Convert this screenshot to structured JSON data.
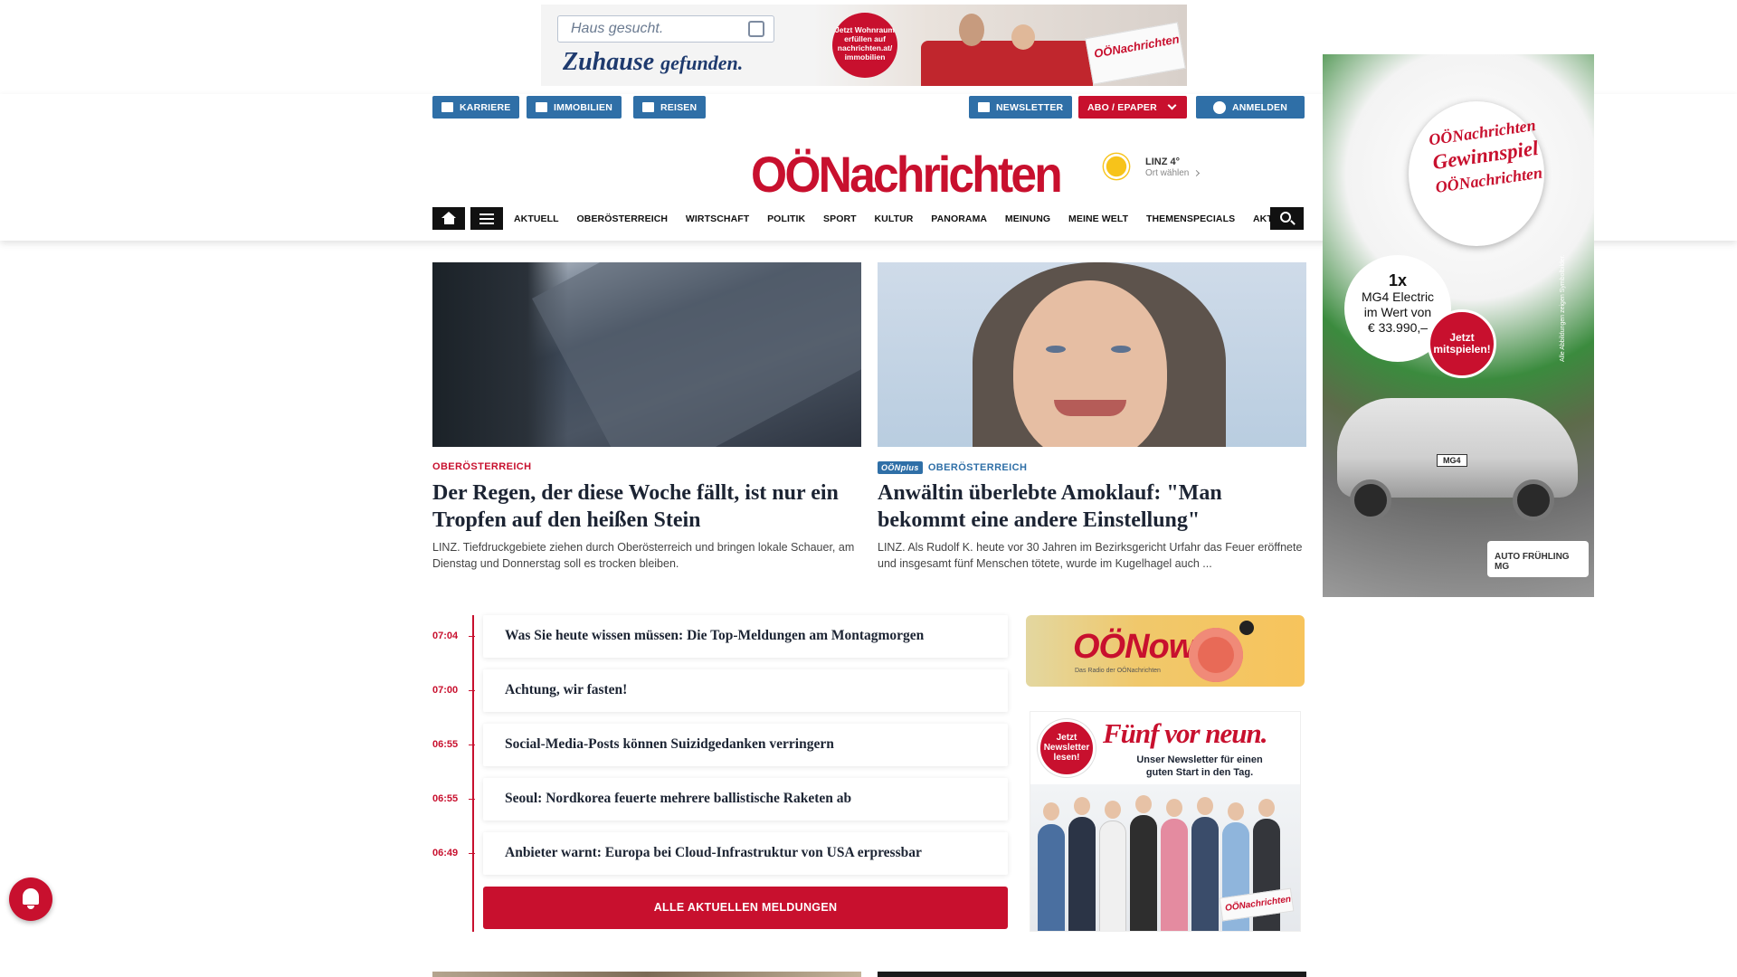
{
  "top_ad": {
    "search_text": "Haus gesucht.",
    "slogan_main": "Zuhause",
    "slogan_rest": "gefunden.",
    "badge": "Jetzt Wohnraum erfüllen auf nachrichten.at/ immobilien",
    "paper_label": "OÖNachrichten"
  },
  "header": {
    "buttons_left": [
      {
        "label": "KARRIERE",
        "icon": "briefcase-icon"
      },
      {
        "label": "IMMOBILIEN",
        "icon": "building-icon"
      },
      {
        "label": "REISEN",
        "icon": "plane-icon"
      }
    ],
    "buttons_right": [
      {
        "label": "NEWSLETTER",
        "icon": "mail-icon"
      },
      {
        "label": "ABO / EPAPER",
        "icon": "chevron-down-icon"
      },
      {
        "label": "ANMELDEN",
        "icon": "user-icon"
      }
    ],
    "logo": "OÖNachrichten",
    "weather": {
      "city": "LINZ 4°",
      "sub": "Ort wählen",
      "icon": "sun-icon"
    }
  },
  "nav": {
    "items": [
      "AKTUELL",
      "OBERÖSTERREICH",
      "WIRTSCHAFT",
      "POLITIK",
      "SPORT",
      "KULTUR",
      "PANORAMA",
      "MEINUNG",
      "MEINE WELT",
      "THEMENSPECIALS",
      "AKTIONEN"
    ]
  },
  "side_ad": {
    "title_top": "OÖNachrichten",
    "title_bottom": "Gewinnspiel",
    "paper": "OÖNachrichten",
    "prize_count": "1x",
    "prize_line1": "MG4 Electric",
    "prize_line2": "im Wert von",
    "prize_line3": "€ 33.990,–",
    "cta": "Jetzt mitspielen!",
    "plate": "MG4",
    "disclaimer": "Alle Abbildungen zeigen Symbolbilder.",
    "logos": "AUTO FRÜHLING  MG"
  },
  "stories": [
    {
      "kicker": "OBERÖSTERREICH",
      "plus": "",
      "headline": "Der Regen, der diese Woche fällt, ist nur ein Tropfen auf den heißen Stein",
      "teaser": "LINZ. Tiefdruckgebiete ziehen durch Oberösterreich und bringen lokale Schauer, am Dienstag und Donnerstag soll es trocken bleiben."
    },
    {
      "kicker": "OBERÖSTERREICH",
      "plus": "OÖNplus",
      "headline": "Anwältin überlebte Amoklauf: \"Man bekommt eine andere Einstellung\"",
      "teaser": "LINZ. Als Rudolf K. heute vor 30 Jahren im Bezirksgericht Urfahr das Feuer eröffnete und insgesamt fünf Menschen tötete, wurde im Kugelhagel auch ..."
    }
  ],
  "timeline": {
    "items": [
      {
        "time": "07:04",
        "title": "Was Sie heute wissen müssen: Die Top-Meldungen am Montagmorgen"
      },
      {
        "time": "07:00",
        "title": "Achtung, wir fasten!"
      },
      {
        "time": "06:55",
        "title": "Social-Media-Posts können Suizidgedanken verringern"
      },
      {
        "time": "06:55",
        "title": "Seoul: Nordkorea feuerte mehrere ballistische Raketen ab"
      },
      {
        "time": "06:49",
        "title": "Anbieter warnt: Europa bei Cloud-Infrastruktur von USA erpressbar"
      }
    ],
    "all_button": "ALLE AKTUELLEN MELDUNGEN"
  },
  "now_box": {
    "title": "OÖNow",
    "sub": "Das Radio der OÖNachrichten"
  },
  "newsletter_box": {
    "title": "Fünf vor neun.",
    "subtitle": "Unser Newsletter für einen guten Start in den Tag.",
    "cta": "Jetzt Newsletter lesen!",
    "paper": "OÖNachrichten"
  },
  "colors": {
    "brand_red": "#c8102e",
    "button_blue": "#2f6fa7"
  }
}
